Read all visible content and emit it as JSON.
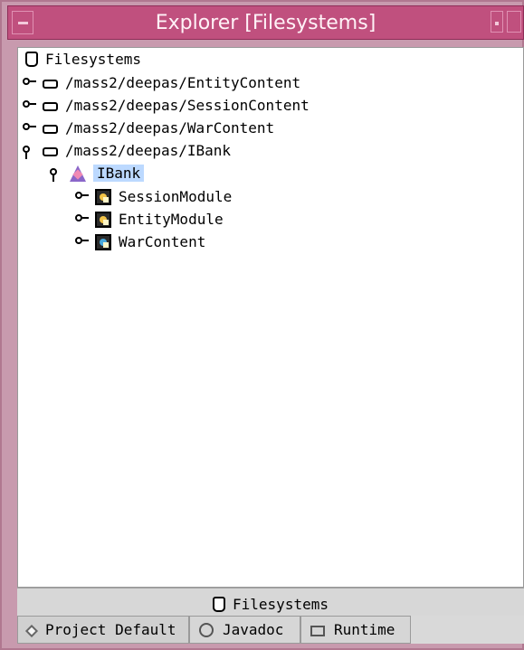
{
  "window": {
    "title": "Explorer [Filesystems]"
  },
  "tree": {
    "root": "Filesystems",
    "items": [
      "/mass2/deepas/EntityContent",
      "/mass2/deepas/SessionContent",
      "/mass2/deepas/WarContent",
      "/mass2/deepas/IBank"
    ],
    "selected": "IBank",
    "children": [
      "SessionModule",
      "EntityModule",
      "WarContent"
    ]
  },
  "bottom_panel": {
    "label": "Filesystems"
  },
  "tabs": [
    "Project Default",
    "Javadoc",
    "Runtime"
  ]
}
